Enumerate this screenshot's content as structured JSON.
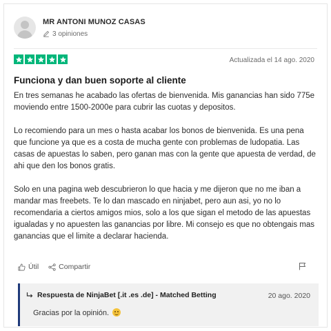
{
  "reviewer": {
    "name": "MR ANTONI MUNOZ CASAS",
    "reviews_count": "3 opiniones"
  },
  "review": {
    "rating": 5,
    "date": "Actualizada el 14 ago. 2020",
    "title": "Funciona y dan buen soporte al cliente",
    "paragraphs": [
      "En tres semanas he acabado las ofertas de bienvenida. Mis ganancias han sido 775e moviendo entre 1500-2000e para cubrir las cuotas y depositos.",
      "Lo recomiendo para un mes o hasta acabar los bonos de bienvenida. Es una pena que funcione ya que es a costa de mucha gente con problemas de ludopatia. Las casas de apuestas lo saben, pero ganan mas con la gente que apuesta de verdad, de ahi que den los bonos gratis.",
      "Solo en una pagina web descubrieron lo que hacia y me dijeron que no me iban a mandar mas freebets. Te lo dan mascado en ninjabet, pero aun asi, yo no lo recomendaria a ciertos amigos mios, solo a los que sigan el metodo de las apuestas igualadas y no apuesten las ganancias por libre. Mi consejo es que no obtengais mas ganancias que el limite a declarar hacienda."
    ]
  },
  "actions": {
    "useful": "Útil",
    "share": "Compartir"
  },
  "reply": {
    "author": "Respuesta de NinjaBet [.it .es .de] - Matched Betting",
    "date": "20 ago. 2020",
    "text": "Gracias por la opinión."
  },
  "colors": {
    "star_green": "#00b67a",
    "reply_border": "#1f3a7a"
  },
  "icons": [
    "avatar",
    "pencil-icon",
    "star-icon",
    "thumbs-up-icon",
    "share-icon",
    "flag-icon",
    "reply-arrow-icon",
    "smiley-emoji"
  ]
}
